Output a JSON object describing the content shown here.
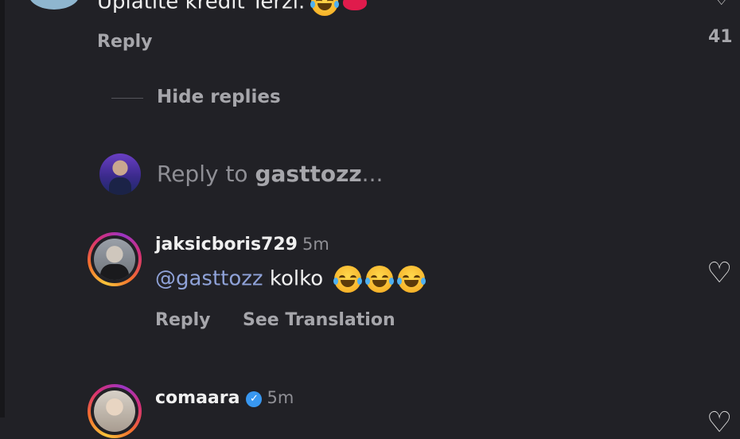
{
  "top_comment": {
    "text": "Uplatite kredit Terzi.",
    "reply_label": "Reply",
    "like_count": "41"
  },
  "thread": {
    "hide_replies_label": "Hide replies"
  },
  "composer": {
    "prefix": "Reply to ",
    "target": "gasttozz",
    "suffix": "..."
  },
  "comments": [
    {
      "username": "jaksicboris729",
      "time": "5m",
      "mention": "@gasttozz",
      "text": "kolko",
      "reply_label": "Reply",
      "translate_label": "See Translation"
    },
    {
      "username": "comaara",
      "time": "5m",
      "verified": true
    }
  ],
  "icons": {
    "like": "heart-outline-icon",
    "verified": "verified-badge-icon",
    "emoji": "tears-of-joy-emoji",
    "kiss": "kiss-mark-emoji"
  },
  "colors": {
    "background": "#212126",
    "mention": "#8fa2d8",
    "verified": "#3897f0",
    "secondary_text": "#a6a6ab"
  }
}
